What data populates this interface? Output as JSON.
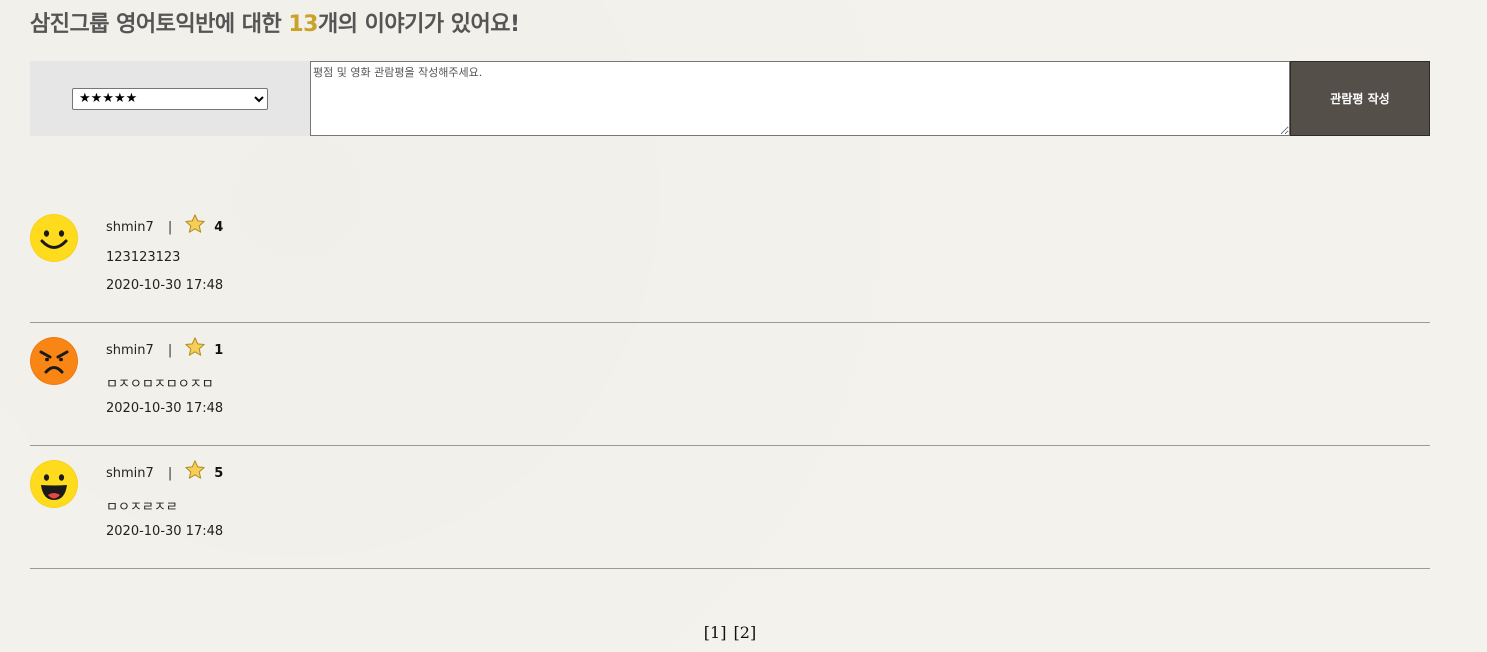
{
  "header": {
    "prefix": "삼진그룹 영어토익반에 대한 ",
    "count": "13",
    "suffix": "개의 이야기가 있어요!",
    "accent_color": "#c9a227"
  },
  "form": {
    "rating_selected": "★★★★★",
    "textarea_placeholder": "평점 및 영화 관람평을 작성해주세요.",
    "submit_label": "관람평 작성",
    "submit_color": "#554f4a"
  },
  "reviews": [
    {
      "user": "shmin7",
      "separator": "|",
      "score": "4",
      "text": "123123123",
      "date": "2020-10-30 17:48",
      "avatar": "smile-face-icon"
    },
    {
      "user": "shmin7",
      "separator": "|",
      "score": "1",
      "text": "ㅁㅈㅇㅁㅈㅁㅇㅈㅁ",
      "date": "2020-10-30 17:48",
      "avatar": "angry-face-icon"
    },
    {
      "user": "shmin7",
      "separator": "|",
      "score": "5",
      "text": "ㅁㅇㅈㄹㅈㄹ",
      "date": "2020-10-30 17:48",
      "avatar": "laughing-face-icon"
    }
  ],
  "pagination": {
    "pages": [
      "[1]",
      "[2]"
    ]
  }
}
